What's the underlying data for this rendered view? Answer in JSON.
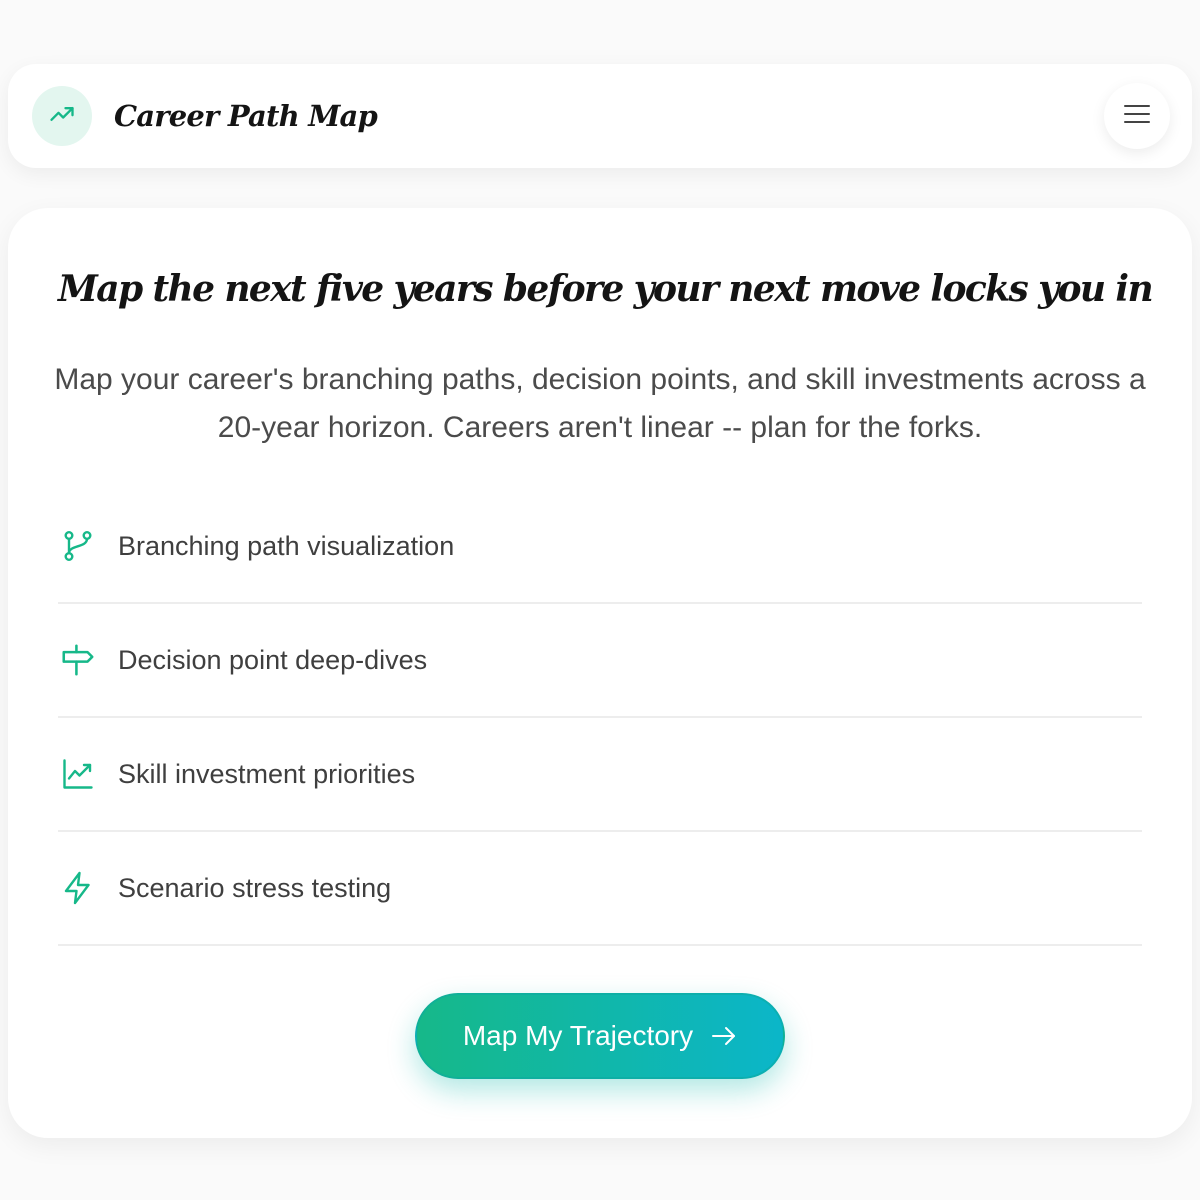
{
  "header": {
    "app_title": "Career Path Map",
    "logo_icon": "trending-up-icon",
    "menu_icon": "hamburger-menu-icon"
  },
  "hero": {
    "headline": "Map the next five years before your next move locks you in",
    "subtitle": "Map your career's branching paths, decision points, and skill investments across a 20-year horizon. Careers aren't linear -- plan for the forks."
  },
  "features": [
    {
      "label": "Branching path visualization",
      "icon": "git-branch-icon"
    },
    {
      "label": "Decision point deep-dives",
      "icon": "signpost-icon"
    },
    {
      "label": "Skill investment priorities",
      "icon": "line-chart-icon"
    },
    {
      "label": "Scenario stress testing",
      "icon": "lightning-bolt-icon"
    }
  ],
  "cta": {
    "label": "Map My Trajectory",
    "icon": "arrow-right-icon"
  },
  "colors": {
    "accent": "#16b889",
    "accent_end": "#0bb6c9",
    "logo_badge_bg": "#e3f6ef"
  }
}
